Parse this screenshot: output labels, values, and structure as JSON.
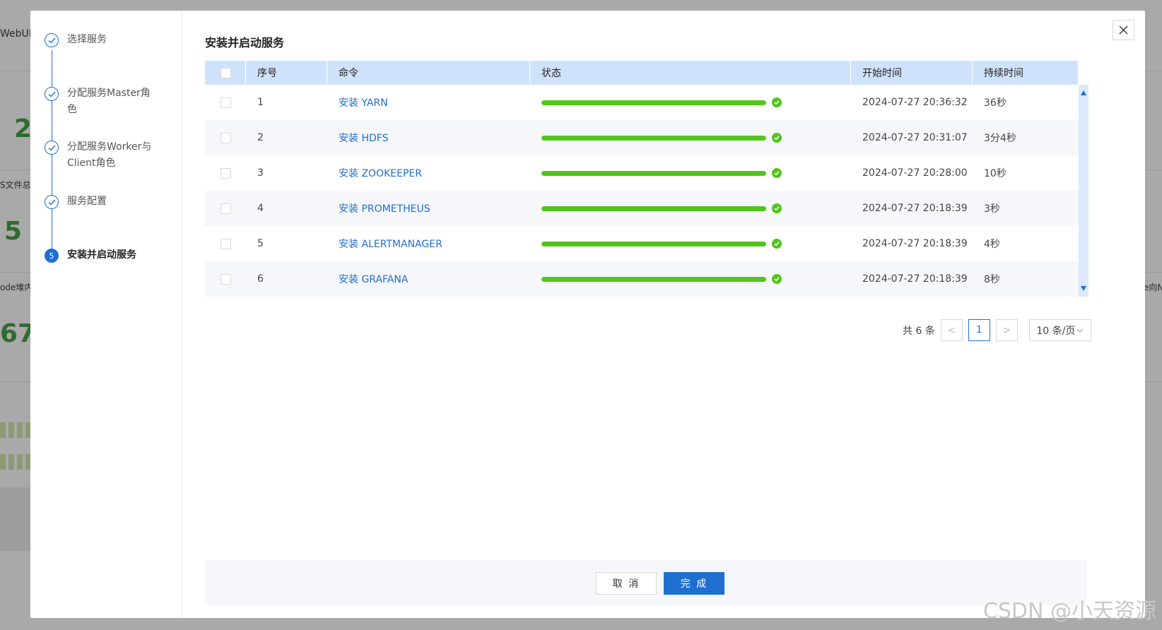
{
  "background": {
    "fragments": [
      "WebUI",
      "S文件总",
      "ode堆内",
      "e向N"
    ],
    "numbers": [
      "2",
      "5",
      "67"
    ]
  },
  "steps": [
    {
      "label": "选择服务",
      "status": "done"
    },
    {
      "label": "分配服务Master角色",
      "status": "done"
    },
    {
      "label": "分配服务Worker与Client角色",
      "status": "done"
    },
    {
      "label": "服务配置",
      "status": "done"
    },
    {
      "label": "安装并启动服务",
      "status": "active",
      "number": "5"
    }
  ],
  "title": "安装并启动服务",
  "close_icon": "close-icon",
  "table": {
    "headers": [
      "序号",
      "命令",
      "状态",
      "开始时间",
      "持续时间"
    ],
    "rows": [
      {
        "no": "1",
        "command": "安装 YARN",
        "progress": 100,
        "start": "2024-07-27 20:36:32",
        "duration": "36秒"
      },
      {
        "no": "2",
        "command": "安装 HDFS",
        "progress": 100,
        "start": "2024-07-27 20:31:07",
        "duration": "3分4秒"
      },
      {
        "no": "3",
        "command": "安装 ZOOKEEPER",
        "progress": 100,
        "start": "2024-07-27 20:28:00",
        "duration": "10秒"
      },
      {
        "no": "4",
        "command": "安装 PROMETHEUS",
        "progress": 100,
        "start": "2024-07-27 20:18:39",
        "duration": "3秒"
      },
      {
        "no": "5",
        "command": "安装 ALERTMANAGER",
        "progress": 100,
        "start": "2024-07-27 20:18:39",
        "duration": "4秒"
      },
      {
        "no": "6",
        "command": "安装 GRAFANA",
        "progress": 100,
        "start": "2024-07-27 20:18:39",
        "duration": "8秒"
      }
    ]
  },
  "pagination": {
    "total": "共 6 条",
    "prev": "<",
    "current": "1",
    "next": ">",
    "page_size": "10 条/页"
  },
  "footer": {
    "cancel": "取 消",
    "done": "完 成"
  },
  "watermark": "CSDN @小天资源",
  "colors": {
    "primary": "#1f6fd1",
    "success": "#52c41a",
    "header_bg": "#cfe2fb"
  }
}
